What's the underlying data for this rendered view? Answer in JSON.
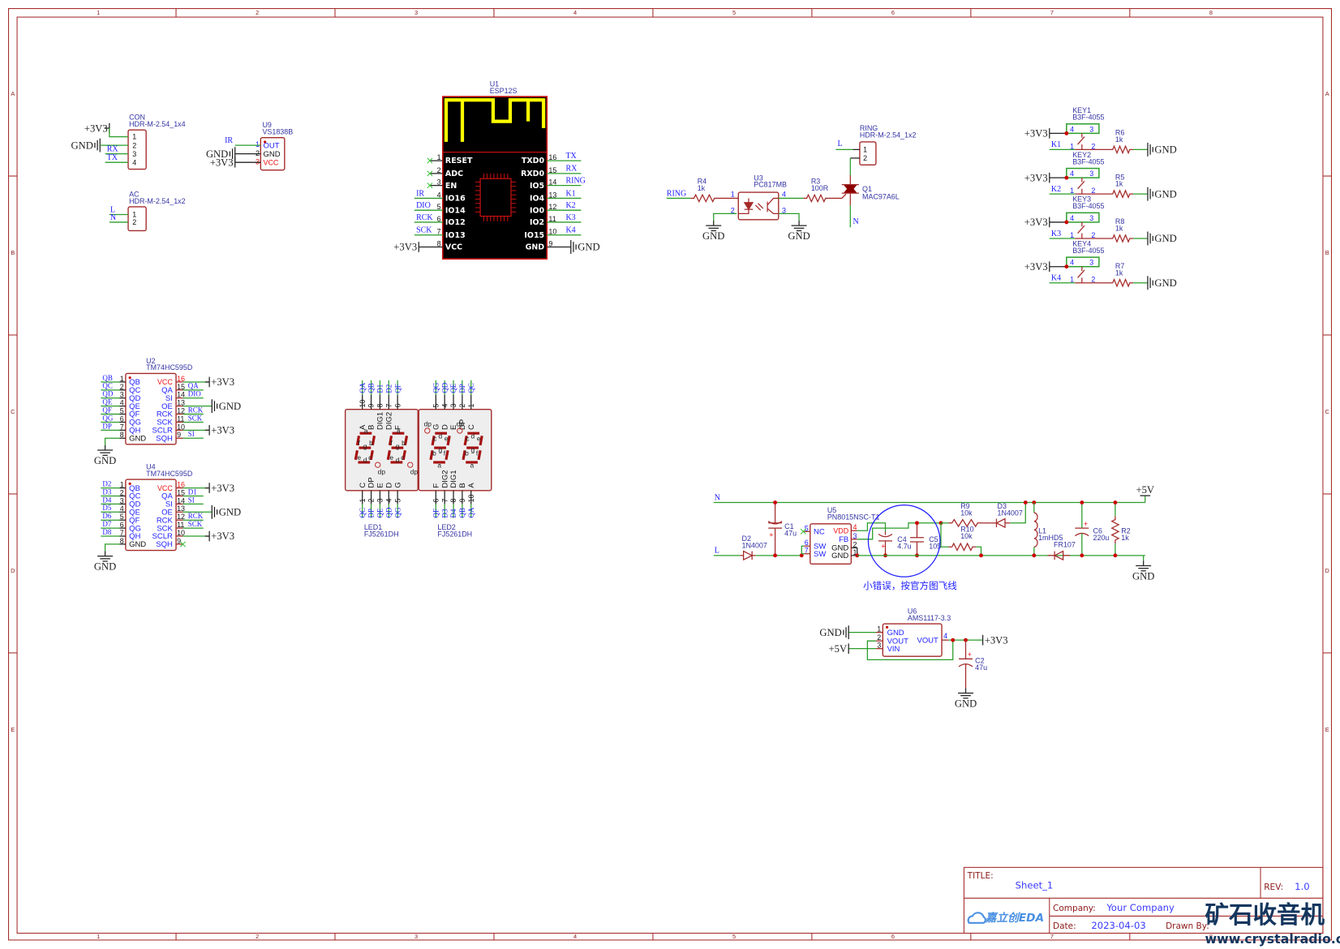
{
  "frame": {
    "columns": [
      "1",
      "2",
      "3",
      "4",
      "5",
      "6",
      "7",
      "8"
    ],
    "rows": [
      "A",
      "B",
      "C",
      "D",
      "E"
    ]
  },
  "colors": {
    "wire": "#2a9d2a",
    "part": "#a52a2a",
    "net_label": "#2020ff",
    "junction": "#cc0000",
    "esp_body": "#000000",
    "antenna": "#ffff00"
  },
  "con": {
    "ref": "CON",
    "value": "HDR-M-2.54_1x4",
    "pins": [
      "1",
      "2",
      "3",
      "4"
    ],
    "nets": [
      "+3V3",
      "GND",
      "RX",
      "TX"
    ]
  },
  "u9": {
    "ref": "U9",
    "value": "VS1838B",
    "pins": [
      {
        "num": "1",
        "name": "OUT"
      },
      {
        "num": "2",
        "name": "GND"
      },
      {
        "num": "3",
        "name": "VCC"
      }
    ],
    "nets": [
      "IR",
      "GND",
      "+3V3"
    ]
  },
  "ac": {
    "ref": "AC",
    "value": "HDR-M-2.54_1x2",
    "pins": [
      "1",
      "2"
    ],
    "nets": [
      "L",
      "N"
    ]
  },
  "u1": {
    "ref": "U1",
    "value": "ESP12S",
    "left": [
      {
        "num": "1",
        "name": "RESET",
        "net": ""
      },
      {
        "num": "2",
        "name": "ADC",
        "net": ""
      },
      {
        "num": "3",
        "name": "EN",
        "net": ""
      },
      {
        "num": "4",
        "name": "IO16",
        "net": "IR"
      },
      {
        "num": "5",
        "name": "IO14",
        "net": "DIO"
      },
      {
        "num": "6",
        "name": "IO12",
        "net": "RCK"
      },
      {
        "num": "7",
        "name": "IO13",
        "net": "SCK"
      },
      {
        "num": "8",
        "name": "VCC",
        "net": "+3V3"
      }
    ],
    "right": [
      {
        "num": "16",
        "name": "TXD0",
        "net": "TX"
      },
      {
        "num": "15",
        "name": "RXD0",
        "net": "RX"
      },
      {
        "num": "14",
        "name": "IO5",
        "net": "RING"
      },
      {
        "num": "13",
        "name": "IO4",
        "net": "K1"
      },
      {
        "num": "12",
        "name": "IO0",
        "net": "K2"
      },
      {
        "num": "11",
        "name": "IO2",
        "net": "K3"
      },
      {
        "num": "10",
        "name": "IO15",
        "net": "K4"
      },
      {
        "num": "9",
        "name": "GND",
        "net": "GND"
      }
    ]
  },
  "ring_section": {
    "net_in": "RING",
    "r4": {
      "ref": "R4",
      "value": "1k"
    },
    "u3": {
      "ref": "U3",
      "value": "PC817MB",
      "pins": [
        "1",
        "2",
        "4",
        "3"
      ]
    },
    "r3": {
      "ref": "R3",
      "value": "100R"
    },
    "q1": {
      "ref": "Q1",
      "value": "MAC97A6L"
    },
    "conn": {
      "ref": "RING",
      "value": "HDR-M-2.54_1x2",
      "pins": [
        "1",
        "2"
      ]
    },
    "net_l": "L",
    "net_n": "N",
    "gnd": "GND"
  },
  "keys": [
    {
      "ref": "KEY1",
      "value": "B3F-4055",
      "net": "K1",
      "pwr": "+3V3",
      "pins": [
        "4",
        "3",
        "1",
        "2"
      ],
      "res_ref": "R6",
      "res_value": "1k",
      "gnd": "GND"
    },
    {
      "ref": "KEY2",
      "value": "B3F-4055",
      "net": "K2",
      "pwr": "+3V3",
      "pins": [
        "4",
        "3",
        "1",
        "2"
      ],
      "res_ref": "R5",
      "res_value": "1k",
      "gnd": "GND"
    },
    {
      "ref": "KEY3",
      "value": "B3F-4055",
      "net": "K3",
      "pwr": "+3V3",
      "pins": [
        "4",
        "3",
        "1",
        "2"
      ],
      "res_ref": "R8",
      "res_value": "1k",
      "gnd": "GND"
    },
    {
      "ref": "KEY4",
      "value": "B3F-4055",
      "net": "K4",
      "pwr": "+3V3",
      "pins": [
        "4",
        "3",
        "1",
        "2"
      ],
      "res_ref": "R7",
      "res_value": "1k",
      "gnd": "GND"
    }
  ],
  "u2": {
    "ref": "U2",
    "value": "TM74HC595D",
    "gnd": "GND",
    "left": [
      {
        "num": "1",
        "name": "QB",
        "net": "QB"
      },
      {
        "num": "2",
        "name": "QC",
        "net": "QC"
      },
      {
        "num": "3",
        "name": "QD",
        "net": "QD"
      },
      {
        "num": "4",
        "name": "QE",
        "net": "QE"
      },
      {
        "num": "5",
        "name": "QF",
        "net": "QF"
      },
      {
        "num": "6",
        "name": "QG",
        "net": "QG"
      },
      {
        "num": "7",
        "name": "QH",
        "net": "DP"
      },
      {
        "num": "8",
        "name": "GND",
        "net": ""
      }
    ],
    "right": [
      {
        "num": "16",
        "name": "VCC",
        "net": "+3V3"
      },
      {
        "num": "15",
        "name": "QA",
        "net": "QA"
      },
      {
        "num": "14",
        "name": "SI",
        "net": "DIO"
      },
      {
        "num": "13",
        "name": "OE",
        "net": "GND"
      },
      {
        "num": "12",
        "name": "RCK",
        "net": "RCK"
      },
      {
        "num": "11",
        "name": "SCK",
        "net": "SCK"
      },
      {
        "num": "10",
        "name": "SCLR",
        "net": "+3V3"
      },
      {
        "num": "9",
        "name": "SQH",
        "net": "SI"
      }
    ]
  },
  "u4": {
    "ref": "U4",
    "value": "TM74HC595D",
    "gnd": "GND",
    "left": [
      {
        "num": "1",
        "name": "QB",
        "net": "D2"
      },
      {
        "num": "2",
        "name": "QC",
        "net": "D3"
      },
      {
        "num": "3",
        "name": "QD",
        "net": "D4"
      },
      {
        "num": "4",
        "name": "QE",
        "net": "D5"
      },
      {
        "num": "5",
        "name": "QF",
        "net": "D6"
      },
      {
        "num": "6",
        "name": "QG",
        "net": "D7"
      },
      {
        "num": "7",
        "name": "QH",
        "net": "D8"
      },
      {
        "num": "8",
        "name": "GND",
        "net": ""
      }
    ],
    "right": [
      {
        "num": "16",
        "name": "VCC",
        "net": "+3V3"
      },
      {
        "num": "15",
        "name": "QA",
        "net": "D1"
      },
      {
        "num": "14",
        "name": "SI",
        "net": "SI"
      },
      {
        "num": "13",
        "name": "OE",
        "net": "GND"
      },
      {
        "num": "12",
        "name": "RCK",
        "net": "RCK"
      },
      {
        "num": "11",
        "name": "SCK",
        "net": "SCK"
      },
      {
        "num": "10",
        "name": "SCLR",
        "net": "+3V3"
      },
      {
        "num": "9",
        "name": "SQH",
        "net": ""
      }
    ]
  },
  "leds": [
    {
      "ref": "LED1",
      "value": "FJ5261DH",
      "top": [
        {
          "num": "10",
          "net": "QA",
          "name": "A"
        },
        {
          "num": "9",
          "net": "QB",
          "name": "B"
        },
        {
          "num": "8",
          "net": "D1",
          "name": "DIG1"
        },
        {
          "num": "7",
          "net": "D2",
          "name": "DIG2"
        },
        {
          "num": "6",
          "net": "QF",
          "name": "F"
        }
      ],
      "bottom": [
        {
          "num": "1",
          "net": "QC",
          "name": "C"
        },
        {
          "num": "2",
          "net": "DP",
          "name": "DP"
        },
        {
          "num": "3",
          "net": "QE",
          "name": "E"
        },
        {
          "num": "4",
          "net": "QD",
          "name": "D"
        },
        {
          "num": "5",
          "net": "QG",
          "name": "G"
        }
      ]
    },
    {
      "ref": "LED2",
      "value": "FJ5261DH",
      "top": [
        {
          "num": "5",
          "net": "QG",
          "name": "G"
        },
        {
          "num": "4",
          "net": "QD",
          "name": "D"
        },
        {
          "num": "3",
          "net": "QE",
          "name": "E"
        },
        {
          "num": "2",
          "net": "DP",
          "name": "DP"
        },
        {
          "num": "1",
          "net": "QC",
          "name": "C"
        }
      ],
      "bottom": [
        {
          "num": "6",
          "net": "QF",
          "name": "F"
        },
        {
          "num": "7",
          "net": "D3",
          "name": "DIG2"
        },
        {
          "num": "8",
          "net": "D4",
          "name": "DIG1"
        },
        {
          "num": "9",
          "net": "QB",
          "name": "B"
        },
        {
          "num": "10",
          "net": "QA",
          "name": "A"
        }
      ]
    }
  ],
  "segments": [
    "a",
    "b",
    "c",
    "d",
    "e",
    "f",
    "g",
    "dp"
  ],
  "power_supply": {
    "net_n": "N",
    "net_l": "L",
    "d2": {
      "ref": "D2",
      "value": "1N4007"
    },
    "c1": {
      "ref": "C1",
      "value": "47u"
    },
    "u5": {
      "ref": "U5",
      "value": "PN8015NSC-T1",
      "left": [
        {
          "num": "5",
          "name": "NC"
        },
        {
          "num": "6",
          "name": "SW"
        },
        {
          "num": "7",
          "name": "SW"
        }
      ],
      "right": [
        {
          "num": "4",
          "name": "VDD"
        },
        {
          "num": "3",
          "name": "FB"
        },
        {
          "num": "2",
          "name": "GND"
        },
        {
          "num": "1",
          "name": "GND"
        }
      ]
    },
    "c4": {
      "ref": "C4",
      "value": "4.7u"
    },
    "c5": {
      "ref": "C5",
      "value": "105"
    },
    "r9": {
      "ref": "R9",
      "value": "10k"
    },
    "r10": {
      "ref": "R10",
      "value": "10k"
    },
    "d3": {
      "ref": "D3",
      "value": "1N4007"
    },
    "l1": {
      "ref": "L1",
      "value": "1mH"
    },
    "d5": {
      "ref": "D5",
      "value": "FR107"
    },
    "c6": {
      "ref": "C6",
      "value": "220u"
    },
    "r2": {
      "ref": "R2",
      "value": "1k"
    },
    "out": "+5V",
    "gnd": "GND",
    "note": "小错误，按官方图飞线"
  },
  "u6": {
    "ref": "U6",
    "value": "AMS1117-3.3",
    "left": [
      {
        "num": "1",
        "name": "GND"
      },
      {
        "num": "2",
        "name": "VOUT"
      },
      {
        "num": "3",
        "name": "VIN"
      }
    ],
    "right": [
      {
        "num": "4",
        "name": "VOUT"
      }
    ],
    "gnd_in": "GND",
    "vin": "+5V",
    "out": "+3V3",
    "c2": {
      "ref": "C2",
      "value": "47u"
    },
    "gnd_out": "GND"
  },
  "title_block": {
    "title_label": "TITLE:",
    "title": "Sheet_1",
    "rev_label": "REV:",
    "rev": "1.0",
    "company_label": "Company:",
    "company": "Your Company",
    "date_label": "Date:",
    "date": "2023-04-03",
    "drawn_by_label": "Drawn By:",
    "logo": "嘉立创EDA"
  },
  "watermark": {
    "text": "矿石收音机",
    "url": "www.crystalradio.cn"
  }
}
